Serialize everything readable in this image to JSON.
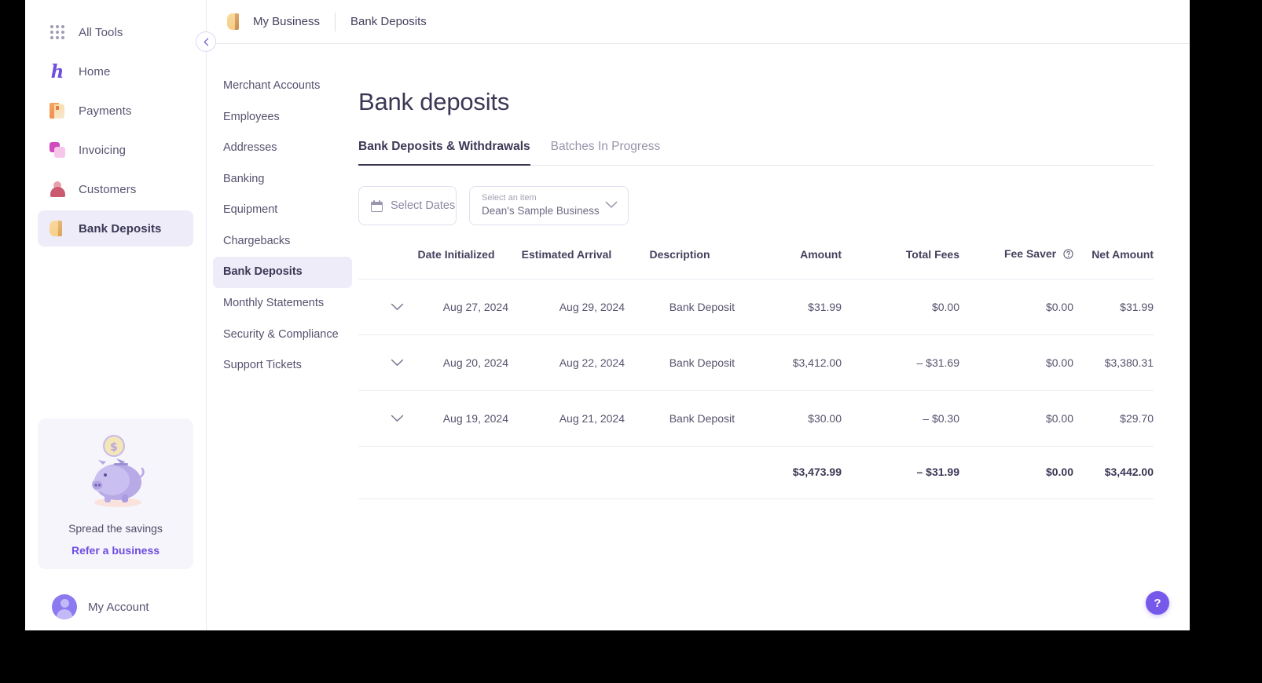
{
  "sidebar": {
    "items": [
      {
        "label": "All Tools",
        "icon": "grid-icon",
        "active": false
      },
      {
        "label": "Home",
        "icon": "h-logo-icon",
        "active": false
      },
      {
        "label": "Payments",
        "icon": "payments-icon",
        "active": false
      },
      {
        "label": "Invoicing",
        "icon": "invoicing-icon",
        "active": false
      },
      {
        "label": "Customers",
        "icon": "customers-icon",
        "active": false
      },
      {
        "label": "Bank Deposits",
        "icon": "bank-deposits-icon",
        "active": true
      }
    ],
    "referral": {
      "title": "Spread the savings",
      "link": "Refer a business",
      "illustration": "piggy-bank-icon"
    },
    "account": {
      "label": "My Account",
      "icon": "avatar-icon"
    },
    "collapse_icon": "chevron-left-icon"
  },
  "breadcrumb": {
    "logo_icon": "business-folder-icon",
    "items": [
      "My Business",
      "Bank Deposits"
    ]
  },
  "secondary_nav": {
    "items": [
      {
        "label": "Merchant Accounts",
        "active": false
      },
      {
        "label": "Employees",
        "active": false
      },
      {
        "label": "Addresses",
        "active": false
      },
      {
        "label": "Banking",
        "active": false
      },
      {
        "label": "Equipment",
        "active": false
      },
      {
        "label": "Chargebacks",
        "active": false
      },
      {
        "label": "Bank Deposits",
        "active": true
      },
      {
        "label": "Monthly Statements",
        "active": false
      },
      {
        "label": "Security & Compliance",
        "active": false
      },
      {
        "label": "Support Tickets",
        "active": false
      }
    ]
  },
  "page": {
    "title": "Bank deposits",
    "tabs": [
      {
        "label": "Bank Deposits & Withdrawals",
        "active": true
      },
      {
        "label": "Batches In Progress",
        "active": false
      }
    ]
  },
  "filters": {
    "date_picker": {
      "label": "Select Dates",
      "icon": "calendar-icon"
    },
    "business_select": {
      "placeholder": "Select an item",
      "value": "Dean's Sample Business",
      "icon": "chevron-down-icon"
    }
  },
  "table": {
    "columns": [
      "Date Initialized",
      "Estimated Arrival",
      "Description",
      "Amount",
      "Total Fees",
      "Fee Saver",
      "Net Amount"
    ],
    "fee_saver_info_icon": "info-circle-icon",
    "row_expand_icon": "chevron-down-icon",
    "rows": [
      {
        "date_initialized": "Aug 27, 2024",
        "estimated_arrival": "Aug 29, 2024",
        "description": "Bank Deposit",
        "amount": "$31.99",
        "total_fees": "$0.00",
        "fee_saver": "$0.00",
        "net_amount": "$31.99"
      },
      {
        "date_initialized": "Aug 20, 2024",
        "estimated_arrival": "Aug 22, 2024",
        "description": "Bank Deposit",
        "amount": "$3,412.00",
        "total_fees": "– $31.69",
        "fee_saver": "$0.00",
        "net_amount": "$3,380.31"
      },
      {
        "date_initialized": "Aug 19, 2024",
        "estimated_arrival": "Aug 21, 2024",
        "description": "Bank Deposit",
        "amount": "$30.00",
        "total_fees": "– $0.30",
        "fee_saver": "$0.00",
        "net_amount": "$29.70"
      }
    ],
    "totals": {
      "amount": "$3,473.99",
      "total_fees": "– $31.99",
      "fee_saver": "$0.00",
      "net_amount": "$3,442.00"
    }
  },
  "help": {
    "label": "?"
  },
  "colors": {
    "accent": "#6f4de0",
    "positive": "#559665",
    "negative": "#d35f6e",
    "active_bg": "#eeecf8",
    "text": "#3b3856"
  }
}
